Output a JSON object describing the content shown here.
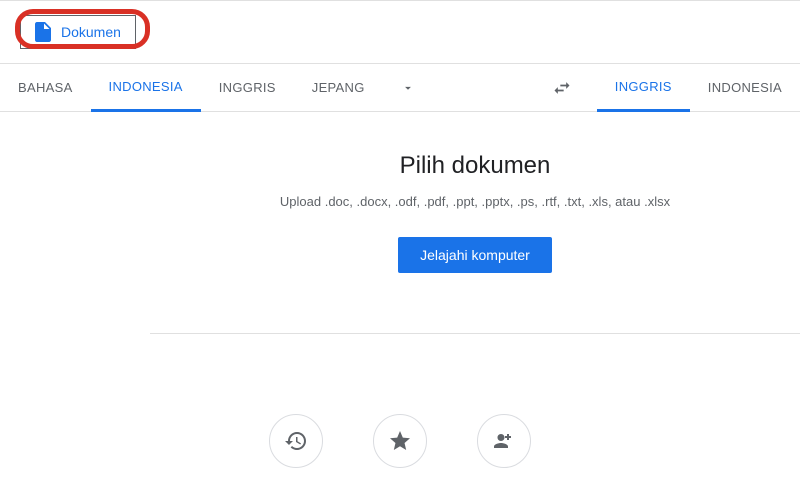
{
  "toolbar": {
    "dokumen_label": "Dokumen"
  },
  "source_langs": {
    "detect": "BAHASA",
    "lang1": "INDONESIA",
    "lang2": "INGGRIS",
    "lang3": "JEPANG"
  },
  "target_langs": {
    "lang1": "INGGRIS",
    "lang2": "INDONESIA"
  },
  "main": {
    "title": "Pilih dokumen",
    "subtitle": "Upload .doc, .docx, .odf, .pdf, .ppt, .pptx, .ps, .rtf, .txt, .xls, atau .xlsx",
    "browse_label": "Jelajahi komputer"
  }
}
